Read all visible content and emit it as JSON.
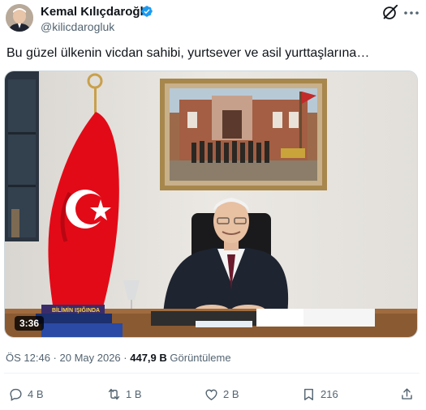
{
  "author": {
    "name": "Kemal Kılıçdaroğlu",
    "handle": "@kilicdarogluk",
    "verified": true,
    "avatar_icon": "avatar-photo"
  },
  "tweet": {
    "text": "Bu güzel ülkenin vicdan sahibi, yurtsever ve asil yurttaşlarına…"
  },
  "media": {
    "duration": "3:36",
    "book_text": "BİLİMİN IŞIĞINDA"
  },
  "meta": {
    "time": "ÖS 12:46",
    "separator": " · ",
    "date": "20 May 2026",
    "views_count": "447,9 B",
    "views_label": "Görüntüleme"
  },
  "actions": {
    "replies": "4 B",
    "reposts": "1 B",
    "likes": "2 B",
    "bookmarks": "216"
  },
  "colors": {
    "verified": "#1d9bf0",
    "text": "#0f1419",
    "muted": "#536471",
    "flag_red": "#e30a17"
  }
}
